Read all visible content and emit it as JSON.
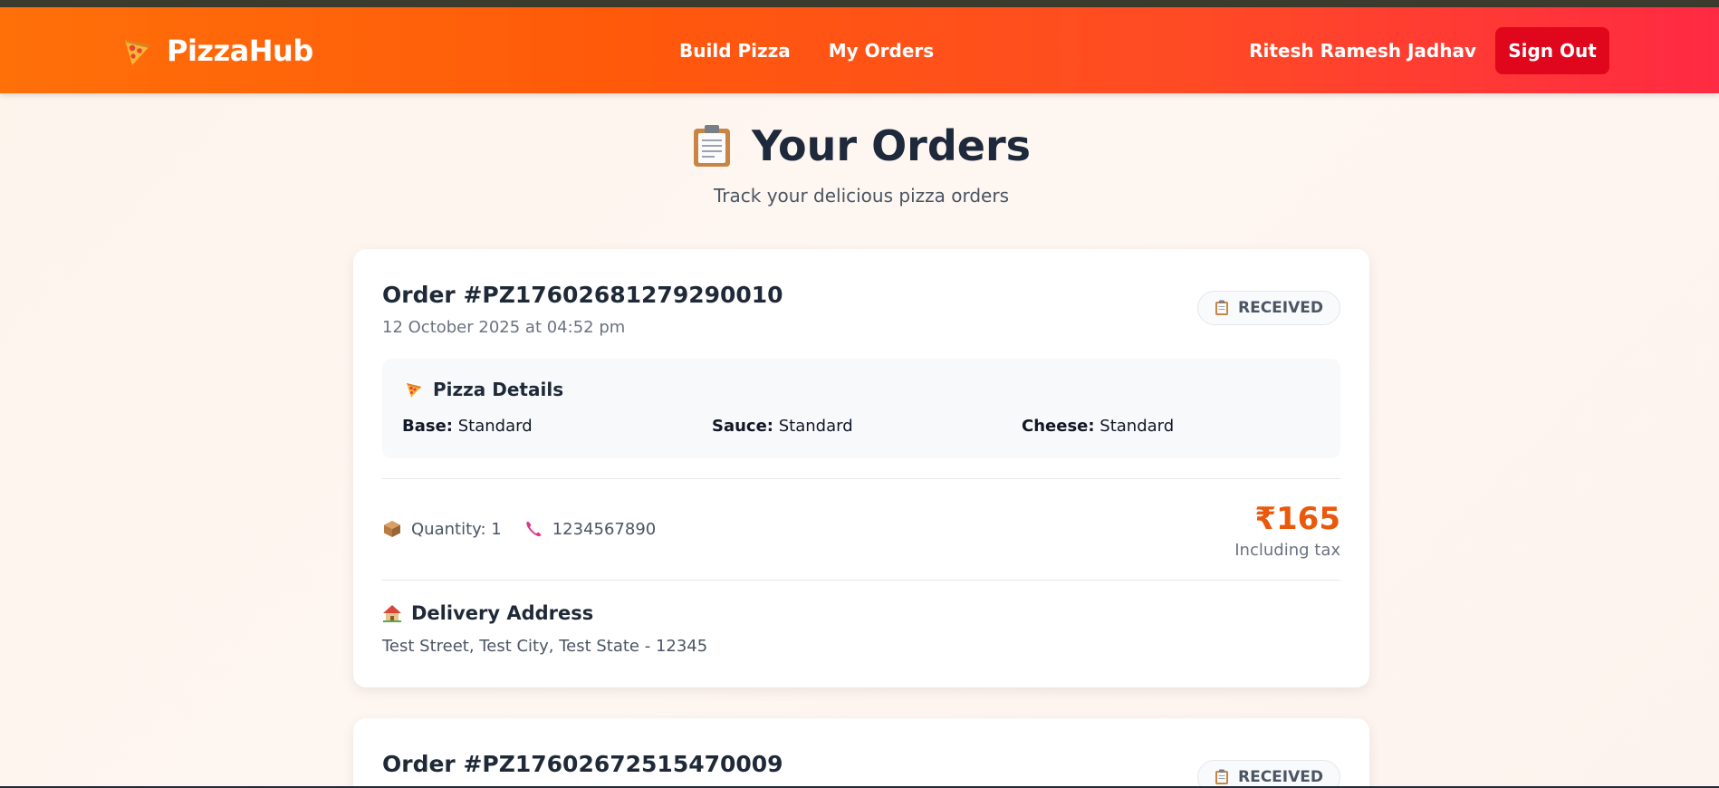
{
  "navbar": {
    "brand": "PizzaHub",
    "brand_icon": "pizza-slice-icon",
    "links": [
      "Build Pizza",
      "My Orders"
    ],
    "user_name": "Ritesh Ramesh Jadhav",
    "signout_label": "Sign Out"
  },
  "page": {
    "title": "Your Orders",
    "title_icon": "clipboard-icon",
    "subtitle": "Track your delicious pizza orders"
  },
  "orders": [
    {
      "id": "Order #PZ17602681279290010",
      "date": "12 October 2025 at 04:52 pm",
      "status": "RECEIVED",
      "details_title": "Pizza Details",
      "base_label": "Base:",
      "base": "Standard",
      "sauce_label": "Sauce:",
      "sauce": "Standard",
      "cheese_label": "Cheese:",
      "cheese": "Standard",
      "quantity": "Quantity: 1",
      "phone": "1234567890",
      "price": "₹165",
      "tax_note": "Including tax",
      "address_title": "Delivery Address",
      "address": "Test Street, Test City, Test State - 12345"
    },
    {
      "id": "Order #PZ17602672515470009",
      "status": "RECEIVED"
    }
  ],
  "colors": {
    "nav_gradient_start": "#ff7009",
    "nav_gradient_end": "#ff2a43",
    "signout_bg": "#e0061c",
    "price": "#ea580c",
    "title_text": "#1e293b"
  }
}
